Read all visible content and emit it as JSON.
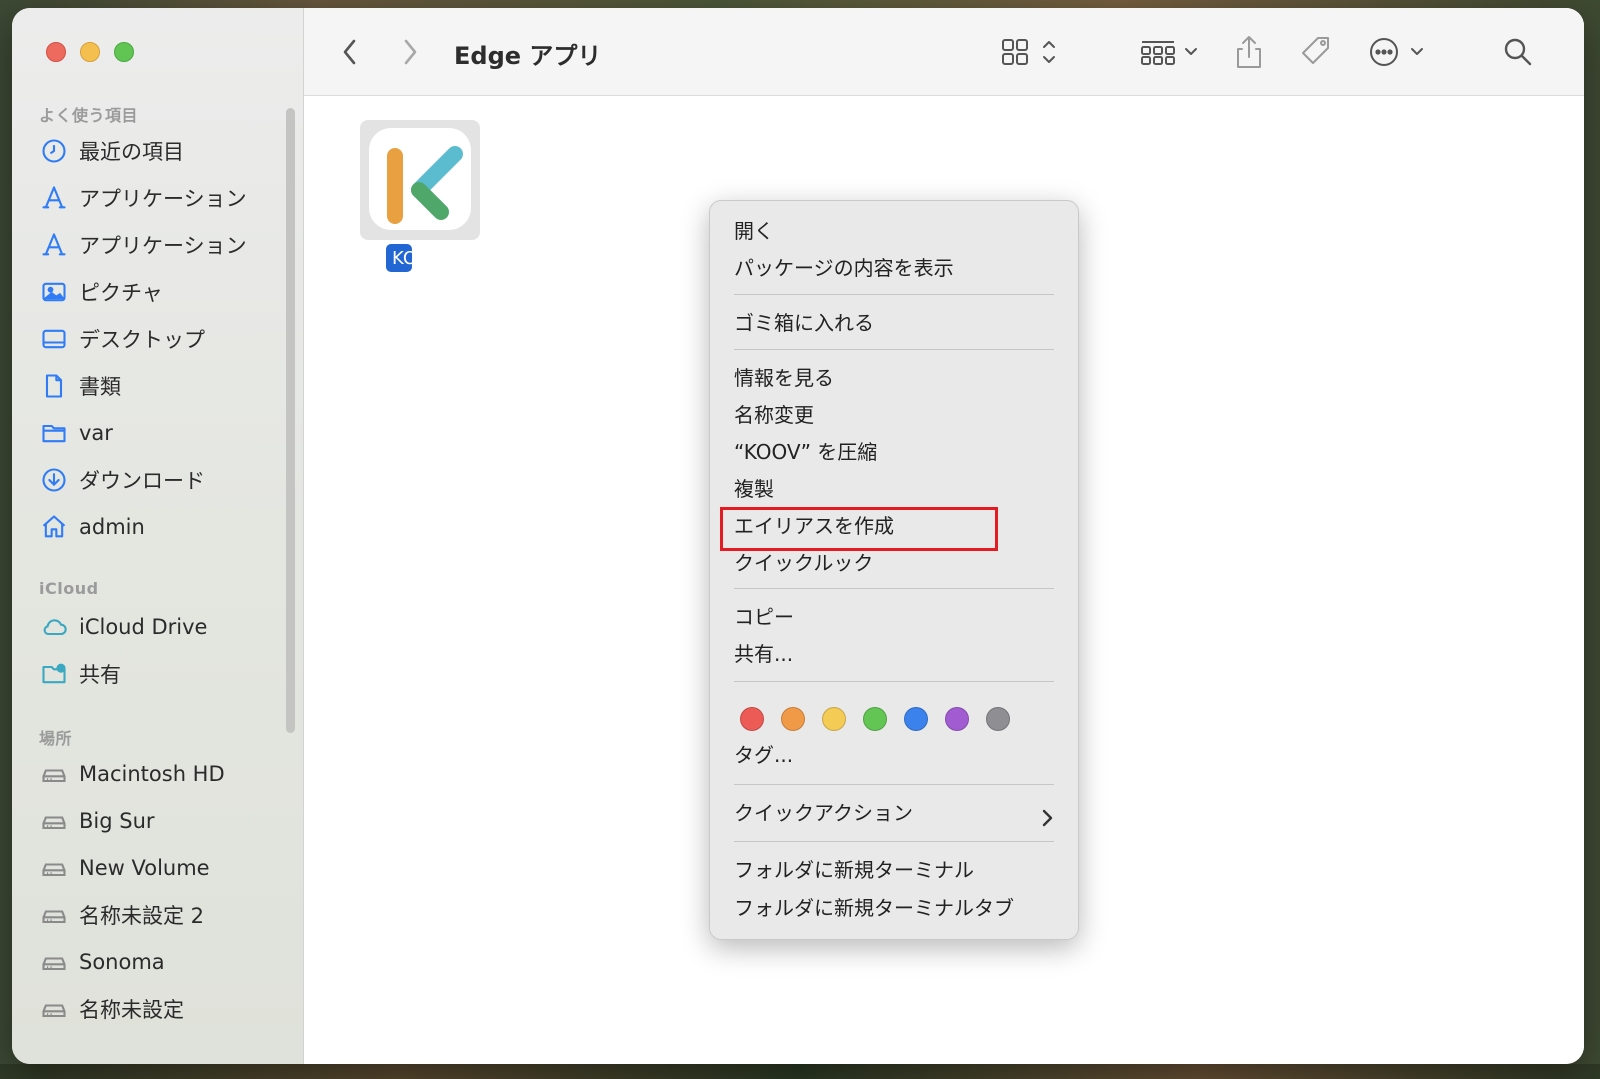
{
  "window": {
    "title": "Edge アプリ"
  },
  "sidebar": {
    "favorites_header": "よく使う項目",
    "favorites": [
      {
        "label": "最近の項目",
        "icon": "clock-icon"
      },
      {
        "label": "アプリケーション",
        "icon": "applications-icon"
      },
      {
        "label": "アプリケーション",
        "icon": "applications-icon"
      },
      {
        "label": "ピクチャ",
        "icon": "pictures-icon"
      },
      {
        "label": "デスクトップ",
        "icon": "desktop-icon"
      },
      {
        "label": "書類",
        "icon": "document-icon"
      },
      {
        "label": "var",
        "icon": "folder-icon"
      },
      {
        "label": "ダウンロード",
        "icon": "download-icon"
      },
      {
        "label": "admin",
        "icon": "home-icon"
      }
    ],
    "icloud_header": "iCloud",
    "icloud": [
      {
        "label": "iCloud Drive",
        "icon": "cloud-icon"
      },
      {
        "label": "共有",
        "icon": "shared-folder-icon"
      }
    ],
    "locations_header": "場所",
    "locations": [
      {
        "label": "Macintosh HD",
        "icon": "disk-icon"
      },
      {
        "label": "Big Sur",
        "icon": "disk-icon"
      },
      {
        "label": "New Volume",
        "icon": "disk-icon"
      },
      {
        "label": "名称未設定 2",
        "icon": "disk-icon"
      },
      {
        "label": "Sonoma",
        "icon": "disk-icon"
      },
      {
        "label": "名称未設定",
        "icon": "disk-icon"
      }
    ]
  },
  "file": {
    "name": "KOOV",
    "label_visible": "KO"
  },
  "context_menu": {
    "items": [
      "開く",
      "パッケージの内容を表示",
      "ゴミ箱に入れる",
      "情報を見る",
      "名称変更",
      "“KOOV” を圧縮",
      "複製",
      "エイリアスを作成",
      "クイックルック",
      "コピー",
      "共有...",
      "タグ...",
      "クイックアクション",
      "フォルダに新規ターミナル",
      "フォルダに新規ターミナルタブ"
    ],
    "highlighted_item": "エイリアスを作成",
    "tag_colors": [
      "#ec5b55",
      "#f09a48",
      "#f4cb55",
      "#62c554",
      "#3b82ec",
      "#a25cd1",
      "#8e8e93"
    ]
  },
  "colors": {
    "accent": "#2266d3",
    "sidebar_icon": "#2f7cf6",
    "highlight_box": "#e31c24"
  }
}
